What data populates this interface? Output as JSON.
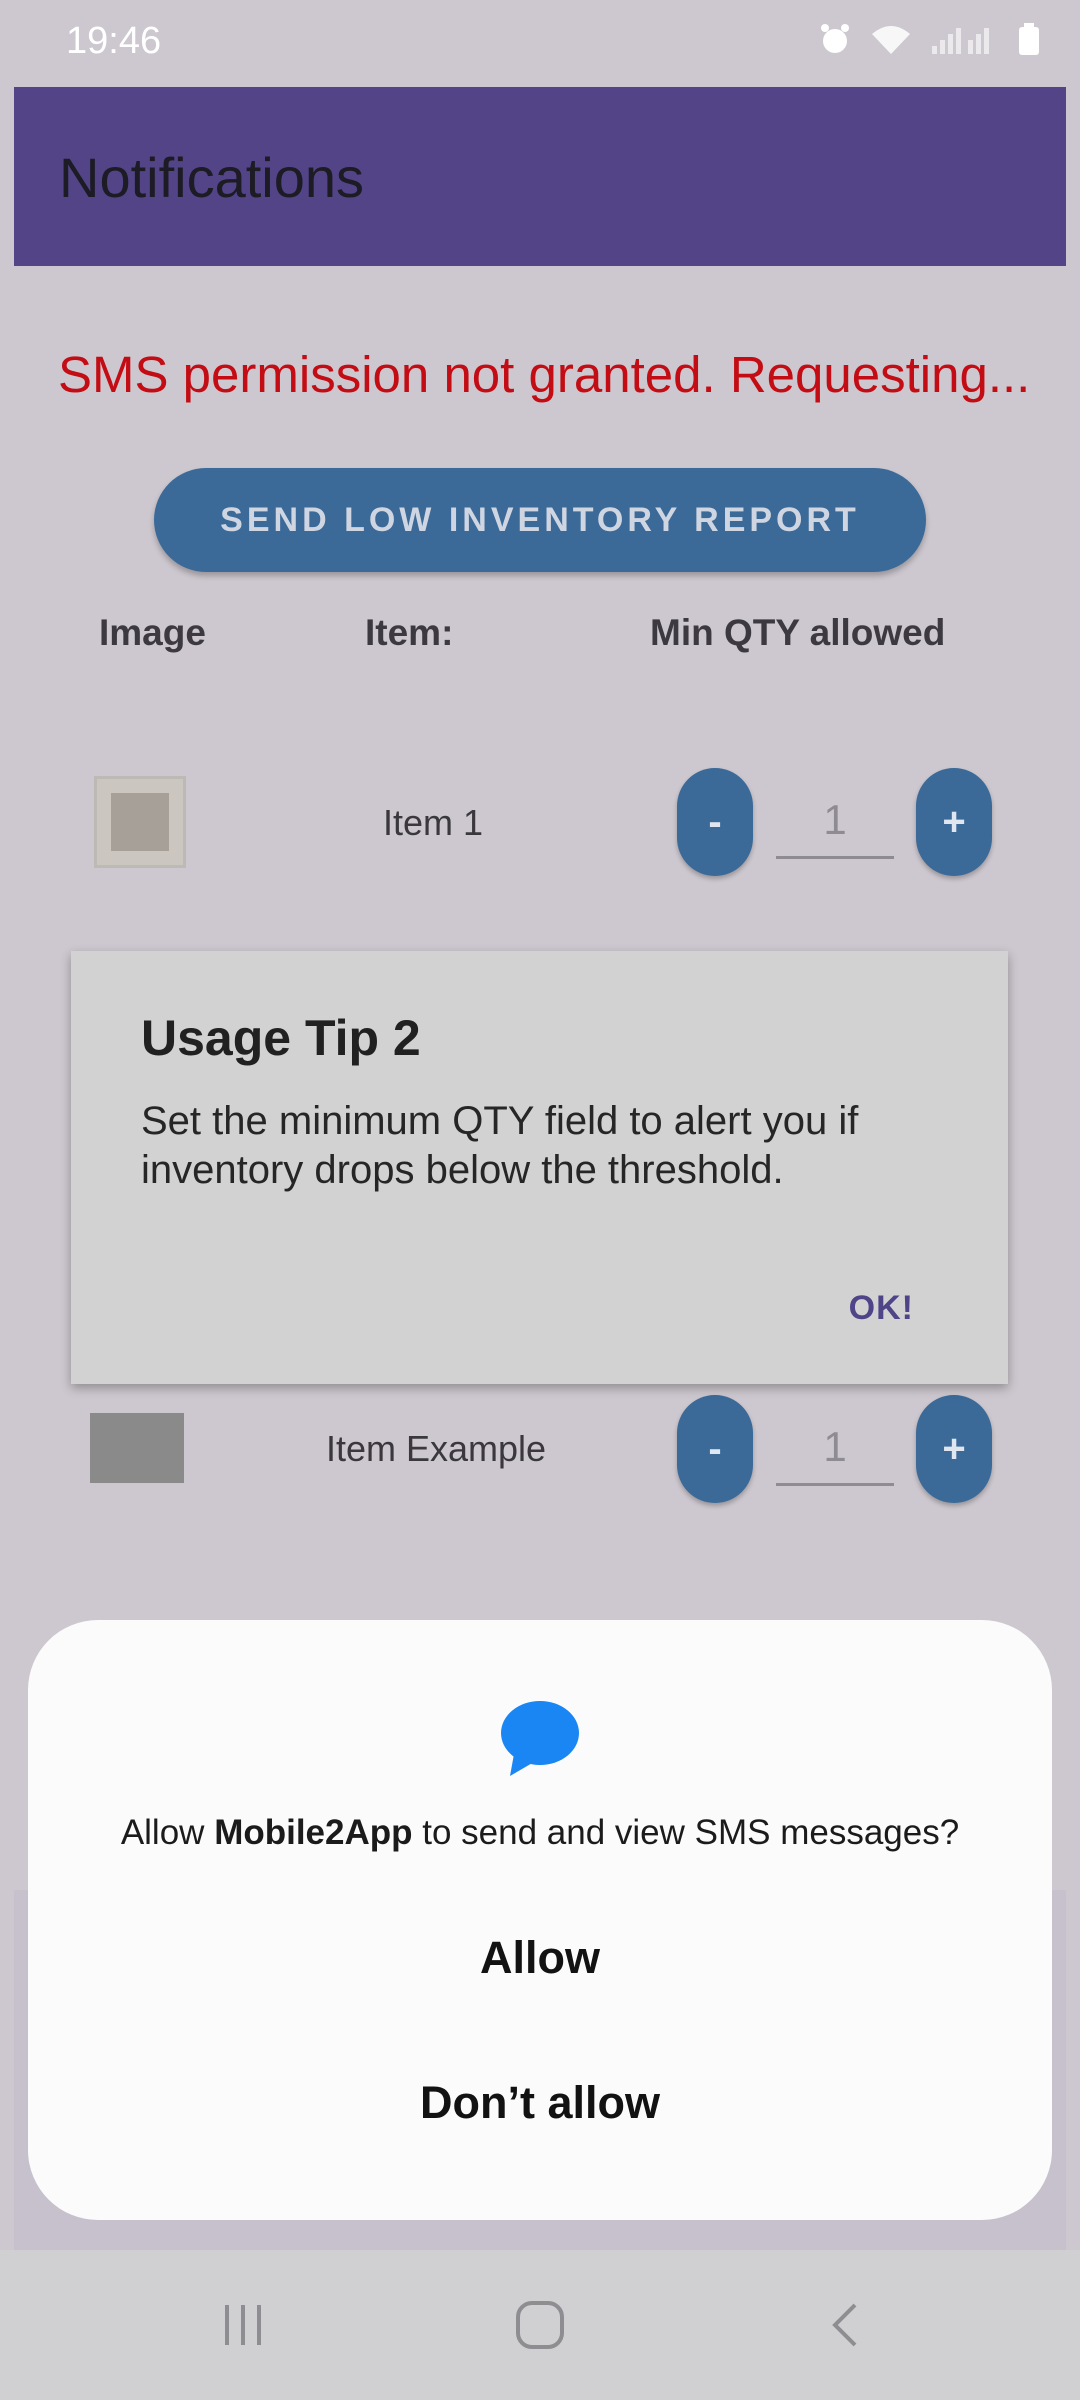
{
  "status_bar": {
    "time": "19:46"
  },
  "app_bar": {
    "title": "Notifications"
  },
  "status_message": "SMS permission not granted. Requesting...",
  "report_button": "SEND LOW INVENTORY REPORT",
  "columns": {
    "image": "Image",
    "item": "Item:",
    "min_qty": "Min QTY allowed"
  },
  "items": [
    {
      "name": "Item 1",
      "qty": "1",
      "minus": "-",
      "plus": "+"
    },
    {
      "name": "Item Example",
      "qty": "1",
      "minus": "-",
      "plus": "+"
    }
  ],
  "tip_dialog": {
    "title": "Usage Tip 2",
    "body": "Set the minimum QTY field to alert you if inventory drops below the threshold.",
    "ok": "OK!"
  },
  "permission": {
    "prefix": "Allow ",
    "app_name": "Mobile2App",
    "suffix": " to send and view SMS messages?",
    "allow": "Allow",
    "deny": "Don’t allow"
  },
  "colors": {
    "accent": "#524487",
    "button": "#3b6a99",
    "error": "#c40c14",
    "sms_icon": "#1a86f3"
  },
  "icons": [
    "alarm-icon",
    "wifi-icon",
    "signal-icon",
    "battery-icon",
    "sms-bubble-icon",
    "recents-icon",
    "home-icon",
    "back-icon"
  ]
}
